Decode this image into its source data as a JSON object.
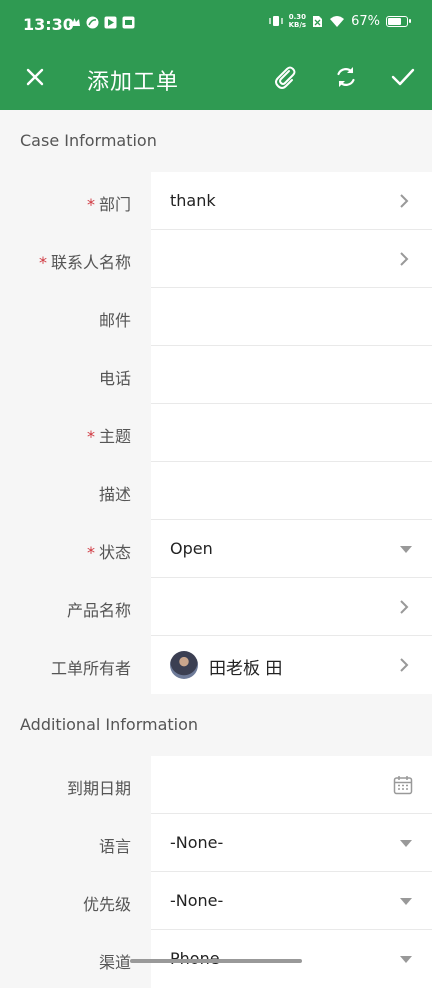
{
  "status_bar": {
    "time": "13:30",
    "net_speed_value": "0.30",
    "net_speed_unit": "KB/s",
    "battery_percent": "67%",
    "battery_level": 0.67
  },
  "app_bar": {
    "title": "添加工单",
    "icons": [
      "close-icon",
      "paperclip-icon",
      "refresh-icon",
      "check-icon"
    ],
    "color": "#2f9a52"
  },
  "sections": {
    "case_info": "Case Information",
    "additional_info": "Additional Information"
  },
  "fields": {
    "department": {
      "label": "部门",
      "required": true,
      "value": "thank"
    },
    "contact_name": {
      "label": "联系人名称",
      "required": true,
      "value": ""
    },
    "email": {
      "label": "邮件",
      "value": ""
    },
    "phone": {
      "label": "电话",
      "value": ""
    },
    "subject": {
      "label": "主题",
      "required": true,
      "value": ""
    },
    "description": {
      "label": "描述",
      "value": ""
    },
    "status": {
      "label": "状态",
      "required": true,
      "value": "Open"
    },
    "product_name": {
      "label": "产品名称",
      "value": ""
    },
    "owner": {
      "label": "工单所有者",
      "value": "田老板 田"
    },
    "due_date": {
      "label": "到期日期",
      "value": ""
    },
    "language": {
      "label": "语言",
      "value": "-None-"
    },
    "priority": {
      "label": "优先级",
      "value": "-None-"
    },
    "channel": {
      "label": "渠道",
      "value": "Phone"
    }
  },
  "required_marker": "*",
  "required_color": "#d0363f"
}
